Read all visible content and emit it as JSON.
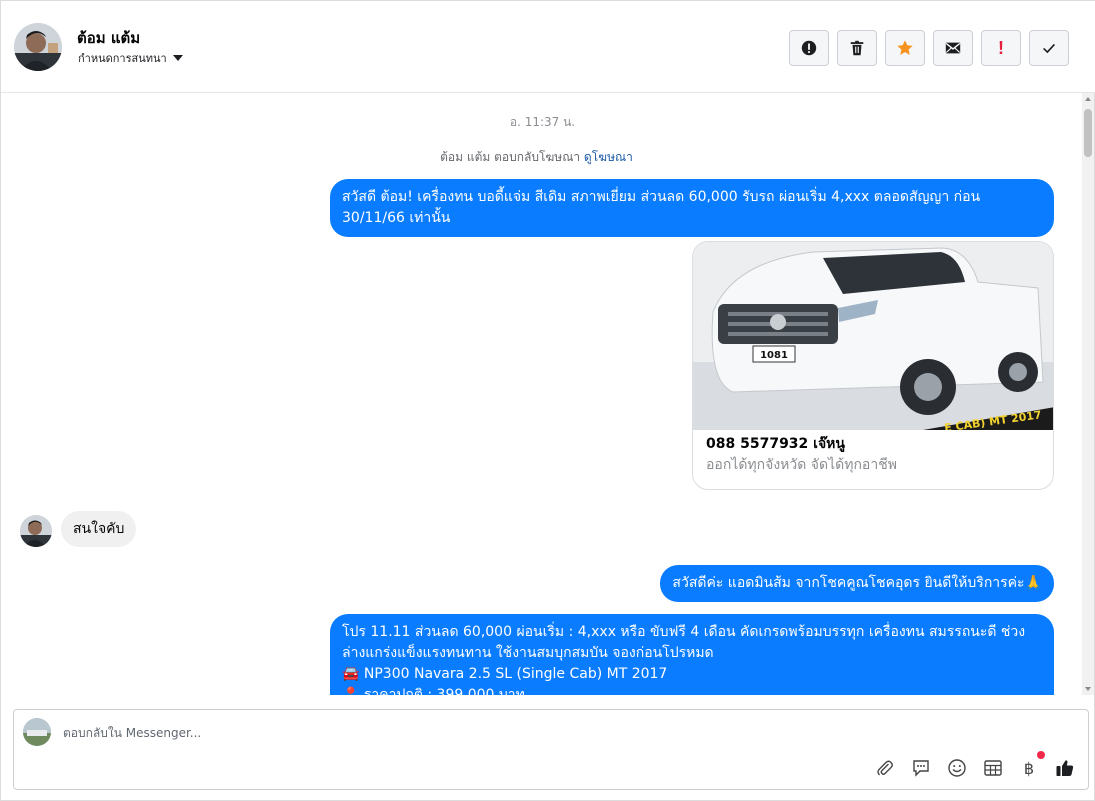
{
  "header": {
    "contact_name": "ต้อม แต้ม",
    "assign_label": "กำหนดการสนทนา",
    "actions": [
      {
        "name": "report-button",
        "icon": "alert-circle-icon"
      },
      {
        "name": "delete-button",
        "icon": "trash-icon"
      },
      {
        "name": "star-button",
        "icon": "star-icon"
      },
      {
        "name": "mark-unread-button",
        "icon": "envelope-icon"
      },
      {
        "name": "mark-important-button",
        "icon": "exclamation-icon"
      },
      {
        "name": "mark-done-button",
        "icon": "check-icon"
      }
    ]
  },
  "messages": {
    "time_separator": "อ. 11:37 น.",
    "ad_reply_prefix": "ต้อม แต้ม ตอบกลับโฆษณา",
    "ad_reply_link": "ดูโฆษณา",
    "outgoing_1": "สวัสดี ต้อม! เครื่องทน บอดี้แจ่ม สีเดิม สภาพเยี่ยม ส่วนลด 60,000 รับรถ ผ่อนเริ่ม 4,xxx ตลอดสัญญา ก่อน 30/11/66 เท่านั้น",
    "ad_card": {
      "title": "088 5577932 เจ๊หนู",
      "subtitle": "ออกได้ทุกจังหวัด จัดได้ทุกอาชีพ",
      "plate_text": "1081",
      "banner_text": "E CAB) MT 2017"
    },
    "incoming_1": "สนใจคับ",
    "outgoing_2": "สวัสดีค่ะ แอดมินส้ม จากโชคคูณโชคอุดร ยินดีให้บริการค่ะ🙏",
    "outgoing_3_line1": "โปร 11.11 ส่วนลด 60,000 ผ่อนเริ่ม : 4,xxx หรือ ขับฟรี 4 เดือน คัดเกรดพร้อมบรรทุก เครื่องทน สมรรถนะดี ช่วงล่างแกร่งแข็งแรงทนทาน ใช้งานสมบุกสมบัน จองก่อนโปรหมด",
    "outgoing_3_line2": "🚘 NP300 Navara 2.5 SL (Single Cab) MT 2017",
    "outgoing_3_line3": "📍 ราคาปกติ : 399,000 บาท"
  },
  "composer": {
    "placeholder": "ตอบกลับใน Messenger...",
    "value": "",
    "tools": [
      "paperclip-icon",
      "chat-bubble-icon",
      "emoji-icon",
      "table-icon",
      "baht-icon",
      "thumbs-up-icon"
    ],
    "baht_symbol": "฿"
  },
  "colors": {
    "bubble_out": "#0a7cff",
    "bubble_in": "#f0f0f0",
    "star": "#f7931e",
    "important": "#e41e3f",
    "notification_dot": "#f02849"
  }
}
